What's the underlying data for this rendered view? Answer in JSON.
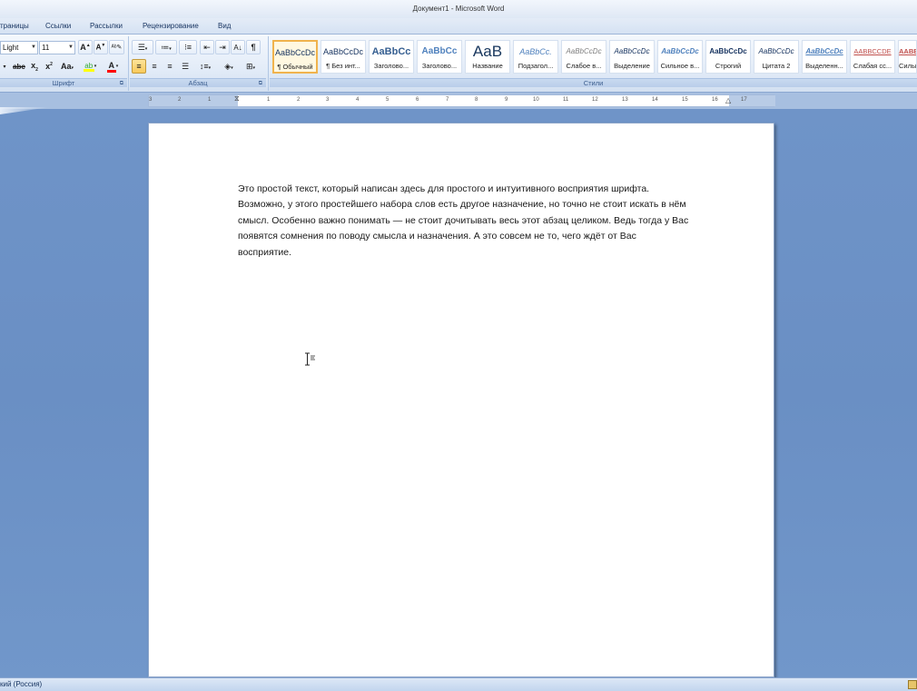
{
  "window": {
    "title": "Документ1 - Microsoft Word"
  },
  "tabs": [
    "траницы",
    "Ссылки",
    "Рассылки",
    "Рецензирование",
    "Вид"
  ],
  "font_group": {
    "font_name": "Light",
    "font_size": "11",
    "title": "Шрифт"
  },
  "paragraph_group": {
    "title": "Абзац"
  },
  "styles_group": {
    "title": "Стили",
    "items": [
      {
        "sample": "AaBbCcDc",
        "name": "¶ Обычный"
      },
      {
        "sample": "AaBbCcDc",
        "name": "¶ Без инт..."
      },
      {
        "sample": "AaBbCc",
        "name": "Заголово..."
      },
      {
        "sample": "AaBbCc",
        "name": "Заголово..."
      },
      {
        "sample": "AaB",
        "name": "Название"
      },
      {
        "sample": "AaBbCc.",
        "name": "Подзагол..."
      },
      {
        "sample": "AaBbCcDc",
        "name": "Слабое в..."
      },
      {
        "sample": "AaBbCcDc",
        "name": "Выделение"
      },
      {
        "sample": "AaBbCcDc",
        "name": "Сильное в..."
      },
      {
        "sample": "AaBbCcDc",
        "name": "Строгий"
      },
      {
        "sample": "AaBbCcDc",
        "name": "Цитата 2"
      },
      {
        "sample": "AaBbCcDc",
        "name": "Выделенн..."
      },
      {
        "sample": "AABBCCDE",
        "name": "Слабая сс..."
      },
      {
        "sample": "AABBC",
        "name": "Сильна"
      }
    ]
  },
  "ruler": {
    "ticks": [
      "3",
      "2",
      "1",
      "1",
      "2",
      "3",
      "4",
      "5",
      "6",
      "7",
      "8",
      "9",
      "10",
      "11",
      "12",
      "13",
      "14",
      "15",
      "16",
      "17"
    ]
  },
  "document": {
    "lines": [
      "Это простой текст, который написан здесь для простого и интуитивного восприятия шрифта.",
      "Возможно, у этого простейшего набора слов есть другое назначение, но точно не стоит искать в нём",
      "смысл. Особенно важно понимать — не стоит дочитывать весь этот абзац целиком. Ведь тогда у Вас",
      "появятся сомнения по поводу смысла и назначения. А это совсем не то, чего ждёт от Вас",
      "восприятие."
    ]
  },
  "statusbar": {
    "language": "кий (Россия)"
  },
  "colors": {
    "accent": "#15325f",
    "highlight": "#ffff00",
    "font_color": "#ff0000",
    "workspace": "#6f94c8",
    "selected_style_border": "#f0b34d"
  },
  "icons": [
    "grow-font-icon",
    "shrink-font-icon",
    "clear-format-icon",
    "strikethrough-icon",
    "subscript-icon",
    "superscript-icon",
    "change-case-icon",
    "highlight-icon",
    "font-color-icon",
    "bullets-icon",
    "numbering-icon",
    "multilevel-list-icon",
    "decrease-indent-icon",
    "increase-indent-icon",
    "sort-icon",
    "pilcrow-icon",
    "align-left-icon",
    "align-center-icon",
    "align-right-icon",
    "justify-icon",
    "line-spacing-icon",
    "shading-icon",
    "borders-icon",
    "text-cursor-icon"
  ]
}
